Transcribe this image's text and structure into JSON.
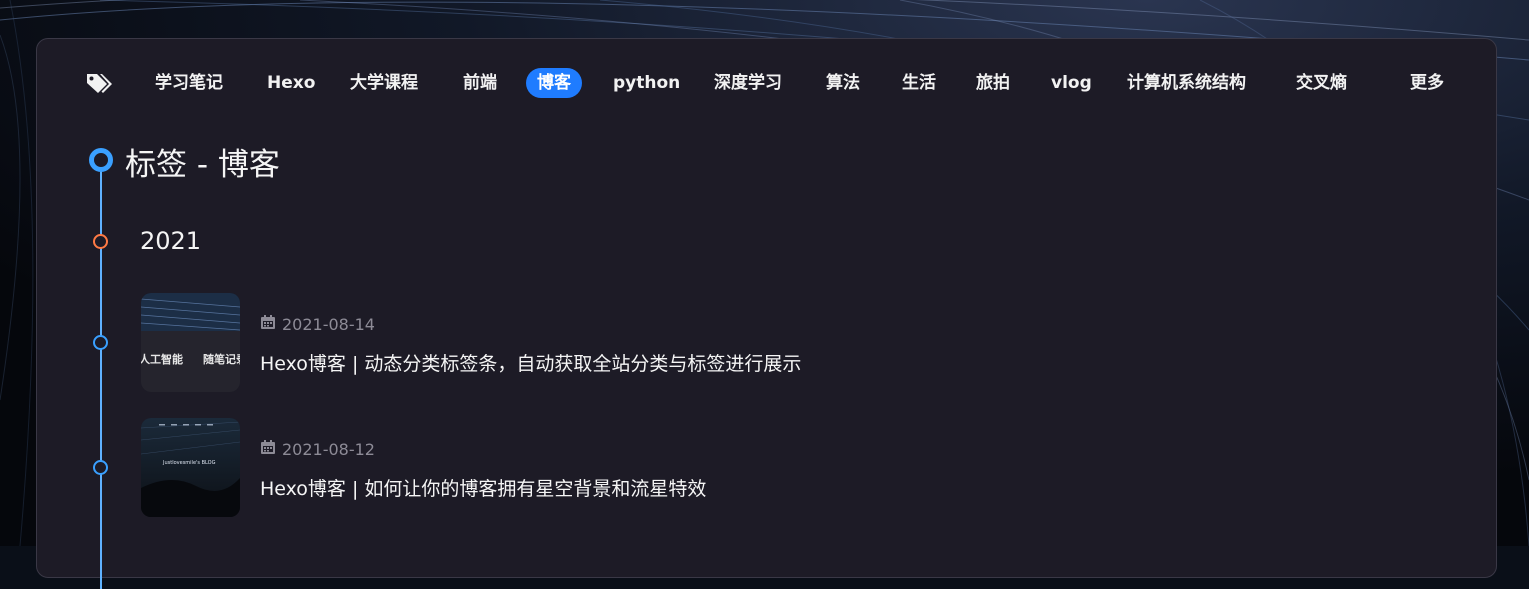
{
  "tag_bar": {
    "icon": "tags-icon",
    "tags": [
      {
        "label": "学习笔记"
      },
      {
        "label": "Hexo"
      },
      {
        "label": "大学课程"
      },
      {
        "label": "前端"
      },
      {
        "label": "博客",
        "active": true
      },
      {
        "label": "python"
      },
      {
        "label": "深度学习"
      },
      {
        "label": "算法"
      },
      {
        "label": "生活"
      },
      {
        "label": "旅拍"
      },
      {
        "label": "vlog"
      },
      {
        "label": "计算机系统结构"
      },
      {
        "label": "交叉熵"
      }
    ],
    "more_label": "更多"
  },
  "page_title": "标签 - 博客",
  "year": "2021",
  "posts": [
    {
      "date": "2021-08-14",
      "title": "Hexo博客 | 动态分类标签条，自动获取全站分类与标签进行展示",
      "thumb_text_left": "人工智能",
      "thumb_text_right": "随笔记录"
    },
    {
      "date": "2021-08-12",
      "title": "Hexo博客 | 如何让你的博客拥有星空背景和流星特效",
      "thumb_text": "Justlovesmile's BLOG"
    }
  ],
  "colors": {
    "accent": "#1f7cff",
    "card_bg": "#1d1b26",
    "timeline": "#5fb2ff",
    "year_node": "#ff7a45"
  }
}
